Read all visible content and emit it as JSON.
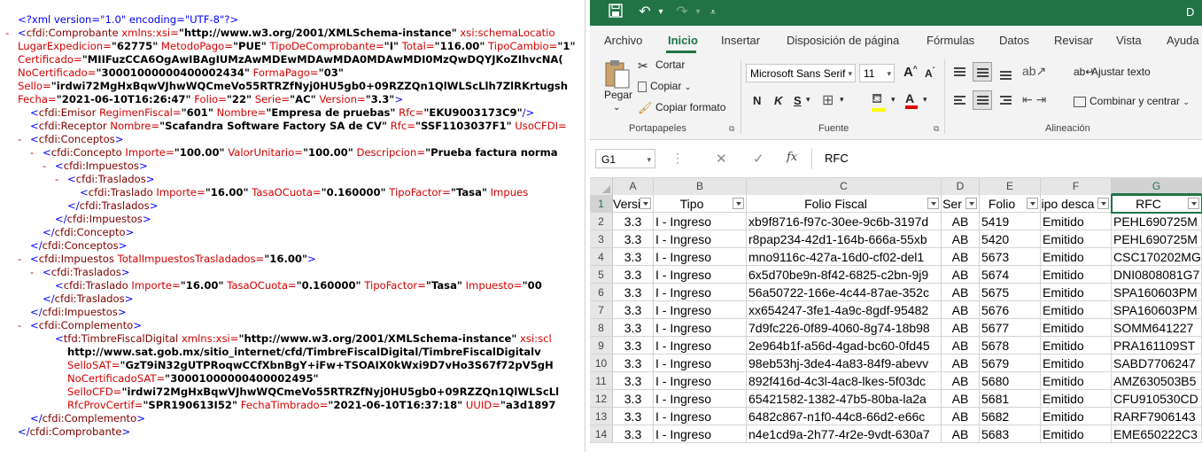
{
  "xml": {
    "lines": [
      {
        "marker": "",
        "parts": [
          {
            "c": "x-b",
            "t": "<?xml version=\"1.0\" encoding=\"UTF-8\"?>"
          }
        ]
      },
      {
        "marker": "-",
        "parts": [
          {
            "c": "x-b",
            "t": "<"
          },
          {
            "c": "x-t",
            "t": "cfdi:Comprobante"
          },
          {
            "c": "x-a",
            "t": " xmlns:xsi="
          },
          {
            "c": "x-v",
            "t": "\"http://www.w3.org/2001/XMLSchema-instance\""
          },
          {
            "c": "x-a",
            "t": " xsi:schemaLocatio"
          }
        ]
      },
      {
        "marker": "",
        "parts": [
          {
            "c": "x-a",
            "t": "LugarExpedicion="
          },
          {
            "c": "x-v",
            "t": "\"62775\""
          },
          {
            "c": "x-a",
            "t": " MetodoPago="
          },
          {
            "c": "x-v",
            "t": "\"PUE\""
          },
          {
            "c": "x-a",
            "t": " TipoDeComprobante="
          },
          {
            "c": "x-v",
            "t": "\"I\""
          },
          {
            "c": "x-a",
            "t": " Total="
          },
          {
            "c": "x-v",
            "t": "\"116.00\""
          },
          {
            "c": "x-a",
            "t": " TipoCambio="
          },
          {
            "c": "x-v",
            "t": "\"1\""
          }
        ]
      },
      {
        "marker": "",
        "parts": [
          {
            "c": "x-a",
            "t": "Certificado="
          },
          {
            "c": "x-v",
            "t": "\"MIIFuzCCA6OgAwIBAgIUMzAwMDEwMDAwMDA0MDAwMDI0MzQwDQYJKoZIhvcNA("
          }
        ]
      },
      {
        "marker": "",
        "parts": [
          {
            "c": "x-a",
            "t": "NoCertificado="
          },
          {
            "c": "x-v",
            "t": "\"30001000000400002434\""
          },
          {
            "c": "x-a",
            "t": " FormaPago="
          },
          {
            "c": "x-v",
            "t": "\"03\""
          }
        ]
      },
      {
        "marker": "",
        "parts": [
          {
            "c": "x-a",
            "t": "Sello="
          },
          {
            "c": "x-v",
            "t": "\"irdwi72MgHxBqwVJhwWQCmeVo55RTRZfNyj0HU5gb0+09RZZQn1QlWLScLlh7ZlRKrtugsh"
          }
        ]
      },
      {
        "marker": "",
        "parts": [
          {
            "c": "x-a",
            "t": "Fecha="
          },
          {
            "c": "x-v",
            "t": "\"2021-06-10T16:26:47\""
          },
          {
            "c": "x-a",
            "t": " Folio="
          },
          {
            "c": "x-v",
            "t": "\"22\""
          },
          {
            "c": "x-a",
            "t": " Serie="
          },
          {
            "c": "x-v",
            "t": "\"AC\""
          },
          {
            "c": "x-a",
            "t": " Version="
          },
          {
            "c": "x-v",
            "t": "\"3.3\""
          },
          {
            "c": "x-b",
            "t": ">"
          }
        ]
      },
      {
        "marker": "",
        "indent": 1,
        "parts": [
          {
            "c": "x-b",
            "t": "<"
          },
          {
            "c": "x-t",
            "t": "cfdi:Emisor"
          },
          {
            "c": "x-a",
            "t": " RegimenFiscal="
          },
          {
            "c": "x-v",
            "t": "\"601\""
          },
          {
            "c": "x-a",
            "t": " Nombre="
          },
          {
            "c": "x-v",
            "t": "\"Empresa de pruebas\""
          },
          {
            "c": "x-a",
            "t": " Rfc="
          },
          {
            "c": "x-v",
            "t": "\"EKU9003173C9\""
          },
          {
            "c": "x-b",
            "t": "/>"
          }
        ]
      },
      {
        "marker": "",
        "indent": 1,
        "parts": [
          {
            "c": "x-b",
            "t": "<"
          },
          {
            "c": "x-t",
            "t": "cfdi:Receptor"
          },
          {
            "c": "x-a",
            "t": " Nombre="
          },
          {
            "c": "x-v",
            "t": "\"Scafandra Software Factory SA de CV\""
          },
          {
            "c": "x-a",
            "t": " Rfc="
          },
          {
            "c": "x-v",
            "t": "\"SSF1103037F1\""
          },
          {
            "c": "x-a",
            "t": " UsoCFDI="
          }
        ]
      },
      {
        "marker": "-",
        "indent": 1,
        "parts": [
          {
            "c": "x-b",
            "t": "<"
          },
          {
            "c": "x-t",
            "t": "cfdi:Conceptos"
          },
          {
            "c": "x-b",
            "t": ">"
          }
        ]
      },
      {
        "marker": "-",
        "indent": 2,
        "parts": [
          {
            "c": "x-b",
            "t": "<"
          },
          {
            "c": "x-t",
            "t": "cfdi:Concepto"
          },
          {
            "c": "x-a",
            "t": " Importe="
          },
          {
            "c": "x-v",
            "t": "\"100.00\""
          },
          {
            "c": "x-a",
            "t": " ValorUnitario="
          },
          {
            "c": "x-v",
            "t": "\"100.00\""
          },
          {
            "c": "x-a",
            "t": " Descripcion="
          },
          {
            "c": "x-v",
            "t": "\"Prueba factura norma"
          }
        ]
      },
      {
        "marker": "-",
        "indent": 3,
        "parts": [
          {
            "c": "x-b",
            "t": "<"
          },
          {
            "c": "x-t",
            "t": "cfdi:Impuestos"
          },
          {
            "c": "x-b",
            "t": ">"
          }
        ]
      },
      {
        "marker": "-",
        "indent": 4,
        "parts": [
          {
            "c": "x-b",
            "t": "<"
          },
          {
            "c": "x-t",
            "t": "cfdi:Traslados"
          },
          {
            "c": "x-b",
            "t": ">"
          }
        ]
      },
      {
        "marker": "",
        "indent": 5,
        "parts": [
          {
            "c": "x-b",
            "t": "<"
          },
          {
            "c": "x-t",
            "t": "cfdi:Traslado"
          },
          {
            "c": "x-a",
            "t": " Importe="
          },
          {
            "c": "x-v",
            "t": "\"16.00\""
          },
          {
            "c": "x-a",
            "t": " TasaOCuota="
          },
          {
            "c": "x-v",
            "t": "\"0.160000\""
          },
          {
            "c": "x-a",
            "t": " TipoFactor="
          },
          {
            "c": "x-v",
            "t": "\"Tasa\""
          },
          {
            "c": "x-a",
            "t": " Impues"
          }
        ]
      },
      {
        "marker": "",
        "indent": 4,
        "parts": [
          {
            "c": "x-b",
            "t": "</"
          },
          {
            "c": "x-t",
            "t": "cfdi:Traslados"
          },
          {
            "c": "x-b",
            "t": ">"
          }
        ]
      },
      {
        "marker": "",
        "indent": 3,
        "parts": [
          {
            "c": "x-b",
            "t": "</"
          },
          {
            "c": "x-t",
            "t": "cfdi:Impuestos"
          },
          {
            "c": "x-b",
            "t": ">"
          }
        ]
      },
      {
        "marker": "",
        "indent": 2,
        "parts": [
          {
            "c": "x-b",
            "t": "</"
          },
          {
            "c": "x-t",
            "t": "cfdi:Concepto"
          },
          {
            "c": "x-b",
            "t": ">"
          }
        ]
      },
      {
        "marker": "",
        "indent": 1,
        "parts": [
          {
            "c": "x-b",
            "t": "</"
          },
          {
            "c": "x-t",
            "t": "cfdi:Conceptos"
          },
          {
            "c": "x-b",
            "t": ">"
          }
        ]
      },
      {
        "marker": "-",
        "indent": 1,
        "parts": [
          {
            "c": "x-b",
            "t": "<"
          },
          {
            "c": "x-t",
            "t": "cfdi:Impuestos"
          },
          {
            "c": "x-a",
            "t": " TotalImpuestosTrasladados="
          },
          {
            "c": "x-v",
            "t": "\"16.00\""
          },
          {
            "c": "x-b",
            "t": ">"
          }
        ]
      },
      {
        "marker": "-",
        "indent": 2,
        "parts": [
          {
            "c": "x-b",
            "t": "<"
          },
          {
            "c": "x-t",
            "t": "cfdi:Traslados"
          },
          {
            "c": "x-b",
            "t": ">"
          }
        ]
      },
      {
        "marker": "",
        "indent": 3,
        "parts": [
          {
            "c": "x-b",
            "t": "<"
          },
          {
            "c": "x-t",
            "t": "cfdi:Traslado"
          },
          {
            "c": "x-a",
            "t": " Importe="
          },
          {
            "c": "x-v",
            "t": "\"16.00\""
          },
          {
            "c": "x-a",
            "t": " TasaOCuota="
          },
          {
            "c": "x-v",
            "t": "\"0.160000\""
          },
          {
            "c": "x-a",
            "t": " TipoFactor="
          },
          {
            "c": "x-v",
            "t": "\"Tasa\""
          },
          {
            "c": "x-a",
            "t": " Impuesto="
          },
          {
            "c": "x-v",
            "t": "\"00"
          }
        ]
      },
      {
        "marker": "",
        "indent": 2,
        "parts": [
          {
            "c": "x-b",
            "t": "</"
          },
          {
            "c": "x-t",
            "t": "cfdi:Traslados"
          },
          {
            "c": "x-b",
            "t": ">"
          }
        ]
      },
      {
        "marker": "",
        "indent": 1,
        "parts": [
          {
            "c": "x-b",
            "t": "</"
          },
          {
            "c": "x-t",
            "t": "cfdi:Impuestos"
          },
          {
            "c": "x-b",
            "t": ">"
          }
        ]
      },
      {
        "marker": "-",
        "indent": 1,
        "parts": [
          {
            "c": "x-b",
            "t": "<"
          },
          {
            "c": "x-t",
            "t": "cfdi:Complemento"
          },
          {
            "c": "x-b",
            "t": ">"
          }
        ]
      },
      {
        "marker": "",
        "indent": 3,
        "parts": [
          {
            "c": "x-b",
            "t": "<"
          },
          {
            "c": "x-t",
            "t": "tfd:TimbreFiscalDigital"
          },
          {
            "c": "x-a",
            "t": " xmlns:xsi="
          },
          {
            "c": "x-v",
            "t": "\"http://www.w3.org/2001/XMLSchema-instance\""
          },
          {
            "c": "x-a",
            "t": " xsi:scl"
          }
        ]
      },
      {
        "marker": "",
        "indent": 4,
        "parts": [
          {
            "c": "x-v",
            "t": "http://www.sat.gob.mx/sitio_internet/cfd/TimbreFiscalDigital/TimbreFiscalDigitalv"
          }
        ]
      },
      {
        "marker": "",
        "indent": 4,
        "parts": [
          {
            "c": "x-a",
            "t": "SelloSAT="
          },
          {
            "c": "x-v",
            "t": "\"GzT9iN32gUTPRoqwCCfXbnBgY+iFw+TSOAIX0kWxi9D7vHo3S67f72pV5gH"
          }
        ]
      },
      {
        "marker": "",
        "indent": 4,
        "parts": [
          {
            "c": "x-a",
            "t": "NoCertificadoSAT="
          },
          {
            "c": "x-v",
            "t": "\"30001000000400002495\""
          }
        ]
      },
      {
        "marker": "",
        "indent": 4,
        "parts": [
          {
            "c": "x-a",
            "t": "SelloCFD="
          },
          {
            "c": "x-v",
            "t": "\"irdwi72MgHxBqwVJhwWQCmeVo55RTRZfNyj0HU5gb0+09RZZQn1QlWLScLl"
          }
        ]
      },
      {
        "marker": "",
        "indent": 4,
        "parts": [
          {
            "c": "x-a",
            "t": "RfcProvCertif="
          },
          {
            "c": "x-v",
            "t": "\"SPR190613I52\""
          },
          {
            "c": "x-a",
            "t": " FechaTimbrado="
          },
          {
            "c": "x-v",
            "t": "\"2021-06-10T16:37:18\""
          },
          {
            "c": "x-a",
            "t": " UUID="
          },
          {
            "c": "x-v",
            "t": "\"a3d1897"
          }
        ]
      },
      {
        "marker": "",
        "indent": 1,
        "parts": [
          {
            "c": "x-b",
            "t": "</"
          },
          {
            "c": "x-t",
            "t": "cfdi:Complemento"
          },
          {
            "c": "x-b",
            "t": ">"
          }
        ]
      },
      {
        "marker": "",
        "parts": [
          {
            "c": "x-b",
            "t": "</"
          },
          {
            "c": "x-t",
            "t": "cfdi:Comprobante"
          },
          {
            "c": "x-b",
            "t": ">"
          }
        ]
      }
    ]
  },
  "excel": {
    "title_fragment": "D",
    "accent_color": "#217346",
    "tabs": [
      "Archivo",
      "Inicio",
      "Insertar",
      "Disposición de página",
      "Fórmulas",
      "Datos",
      "Revisar",
      "Vista",
      "Ayuda"
    ],
    "active_tab": "Inicio",
    "ribbon": {
      "paste_label": "Pegar",
      "cut_label": "Cortar",
      "copy_label": "Copiar",
      "copy_format_label": "Copiar formato",
      "clipboard_group": "Portapapeles",
      "font_name": "Microsoft Sans Serif",
      "font_size": "11",
      "bold": "N",
      "italic": "K",
      "underline": "S",
      "font_group": "Fuente",
      "wrap_label": "Ajustar texto",
      "merge_label": "Combinar y centrar",
      "alignment_group": "Alineación"
    },
    "name_box": "G1",
    "formula_value": "RFC",
    "columns": [
      "A",
      "B",
      "C",
      "D",
      "E",
      "F",
      "G"
    ],
    "headers": [
      "Versi",
      "Tipo",
      "Folio Fiscal",
      "Ser",
      "Folio",
      "ipo desca",
      "RFC"
    ],
    "rows": [
      {
        "num": "2",
        "cells": [
          "3.3",
          "I - Ingreso",
          "xb9f8716-f97c-30ee-9c6b-3197d",
          "AB",
          "5419",
          "Emitido",
          "PEHL690725M"
        ]
      },
      {
        "num": "3",
        "cells": [
          "3.3",
          "I - Ingreso",
          "r8pap234-42d1-164b-666a-55xb",
          "AB",
          "5420",
          "Emitido",
          "PEHL690725M"
        ]
      },
      {
        "num": "4",
        "cells": [
          "3.3",
          "I - Ingreso",
          "mno9116c-427a-16d0-cf02-del1",
          "AB",
          "5673",
          "Emitido",
          "CSC170202MG"
        ]
      },
      {
        "num": "5",
        "cells": [
          "3.3",
          "I - Ingreso",
          "6x5d70be9n-8f42-6825-c2bn-9j9",
          "AB",
          "5674",
          "Emitido",
          "DNI0808081G7"
        ]
      },
      {
        "num": "6",
        "cells": [
          "3.3",
          "I - Ingreso",
          "56a50722-166e-4c44-87ae-352c",
          "AB",
          "5675",
          "Emitido",
          "SPA160603PM"
        ]
      },
      {
        "num": "7",
        "cells": [
          "3.3",
          "I - Ingreso",
          "xx654247-3fe1-4a9c-8gdf-95482",
          "AB",
          "5676",
          "Emitido",
          "SPA160603PM"
        ]
      },
      {
        "num": "8",
        "cells": [
          "3.3",
          "I - Ingreso",
          "7d9fc226-0f89-4060-8g74-18b98",
          "AB",
          "5677",
          "Emitido",
          "SOMM641227"
        ]
      },
      {
        "num": "9",
        "cells": [
          "3.3",
          "I - Ingreso",
          "2e964b1f-a56d-4gad-bc60-0fd45",
          "AB",
          "5678",
          "Emitido",
          "PRA161109ST"
        ]
      },
      {
        "num": "10",
        "cells": [
          "3.3",
          "I - Ingreso",
          "98eb53hj-3de4-4a83-84f9-abevv",
          "AB",
          "5679",
          "Emitido",
          "SABD7706247"
        ]
      },
      {
        "num": "11",
        "cells": [
          "3.3",
          "I - Ingreso",
          "892f416d-4c3l-4ac8-lkes-5f03dc",
          "AB",
          "5680",
          "Emitido",
          "AMZ630503B5"
        ]
      },
      {
        "num": "12",
        "cells": [
          "3.3",
          "I - Ingreso",
          "65421582-1382-47b5-80ba-la2a",
          "AB",
          "5681",
          "Emitido",
          "CFU910530CD"
        ]
      },
      {
        "num": "13",
        "cells": [
          "3.3",
          "I - Ingreso",
          "6482c867-n1f0-44c8-66d2-e66c",
          "AB",
          "5682",
          "Emitido",
          "RARF7906143"
        ]
      },
      {
        "num": "14",
        "cells": [
          "3.3",
          "I - Ingreso",
          "n4e1cd9a-2h77-4r2e-9vdt-630a7",
          "AB",
          "5683",
          "Emitido",
          "EME650222C3"
        ]
      }
    ]
  }
}
